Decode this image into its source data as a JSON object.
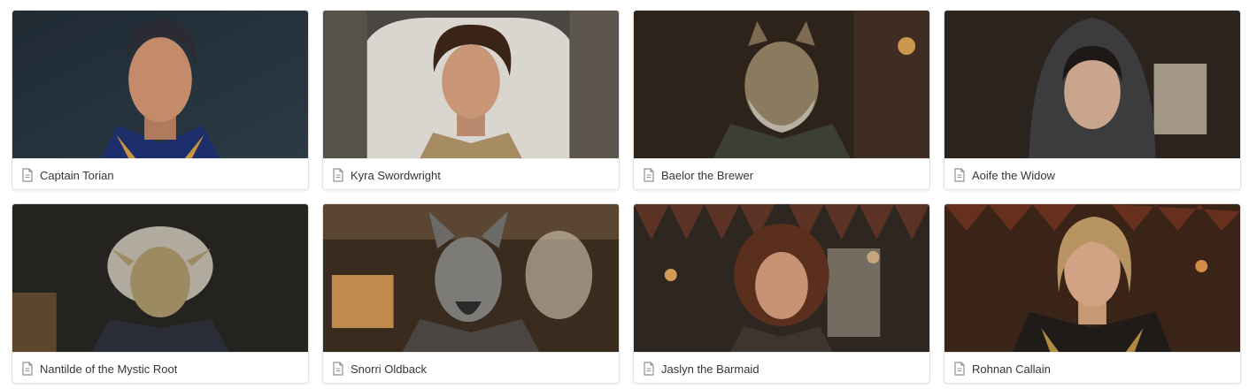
{
  "gallery": {
    "cards": [
      {
        "title": "Captain Torian",
        "icon": "page-icon"
      },
      {
        "title": "Kyra Swordwright",
        "icon": "page-icon"
      },
      {
        "title": "Baelor the Brewer",
        "icon": "page-icon"
      },
      {
        "title": "Aoife the Widow",
        "icon": "page-icon"
      },
      {
        "title": "Nantilde of the Mystic Root",
        "icon": "page-icon"
      },
      {
        "title": "Snorri Oldback",
        "icon": "page-icon"
      },
      {
        "title": "Jaslyn the Barmaid",
        "icon": "page-icon"
      },
      {
        "title": "Rohnan Callain",
        "icon": "page-icon"
      }
    ]
  },
  "colors": {
    "card_border": "#e3e3e1",
    "text": "#37352f",
    "icon": "#91918e"
  }
}
